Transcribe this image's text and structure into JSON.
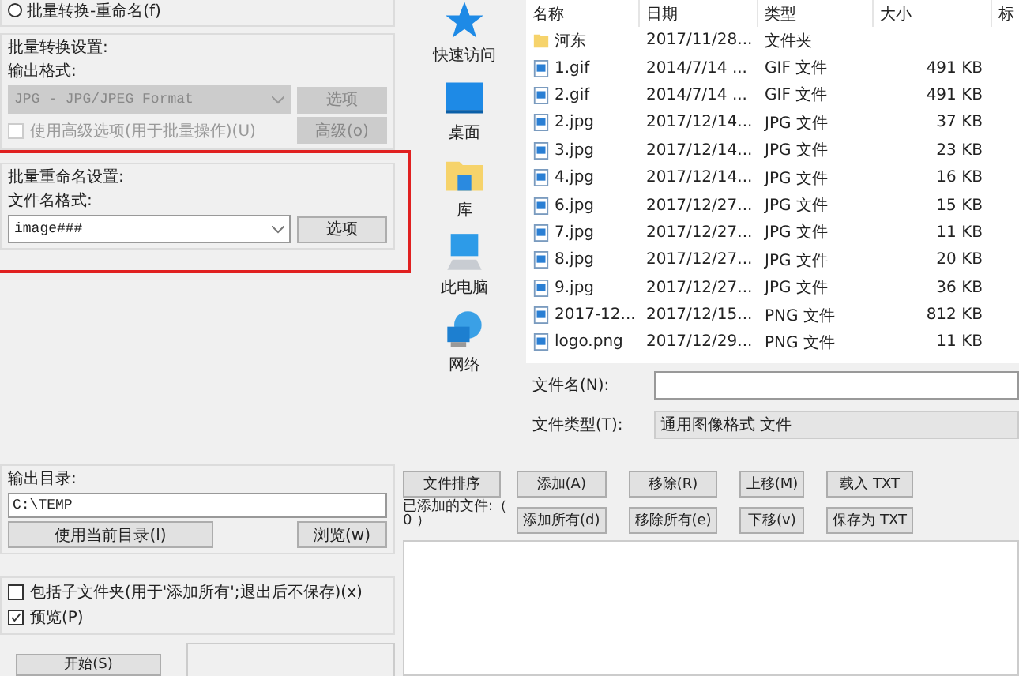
{
  "mode_radios": [
    {
      "label": "批量转换-重命名(f)",
      "selected": false
    }
  ],
  "convert_settings": {
    "title": "批量转换设置:",
    "format_label": "输出格式:",
    "format_value": "JPG - JPG/JPEG Format",
    "options_button": "选项",
    "disabled": true,
    "advanced_checkbox": {
      "label": "使用高级选项(用于批量操作)(U)",
      "checked": false
    },
    "advanced_button": "高级(o)"
  },
  "rename_settings": {
    "title": "批量重命名设置:",
    "pattern_label": "文件名格式:",
    "pattern_value": "image###",
    "options_button": "选项",
    "highlighted": true
  },
  "output_dir": {
    "title": "输出目录:",
    "value": "C:\\TEMP",
    "use_current_button": "使用当前目录(l)",
    "browse_button": "浏览(w)"
  },
  "options": [
    {
      "label": "包括子文件夹(用于'添加所有';退出后不保存)(x)",
      "checked": false
    },
    {
      "label": "预览(P)",
      "checked": true
    }
  ],
  "start_button": "开始(S)",
  "places": [
    {
      "label": "快速访问",
      "kind": "star"
    },
    {
      "label": "桌面",
      "kind": "desktop"
    },
    {
      "label": "库",
      "kind": "library"
    },
    {
      "label": "此电脑",
      "kind": "computer"
    },
    {
      "label": "网络",
      "kind": "network"
    }
  ],
  "file_table": {
    "columns": [
      "名称",
      "日期",
      "类型",
      "大小",
      "标"
    ],
    "rows": [
      {
        "kind": "folder",
        "name": "河东",
        "date": "2017/11/28...",
        "type": "文件夹",
        "size": ""
      },
      {
        "kind": "image",
        "name": "1.gif",
        "date": "2014/7/14 ...",
        "type": "GIF 文件",
        "size": "491 KB"
      },
      {
        "kind": "image",
        "name": "2.gif",
        "date": "2014/7/14 ...",
        "type": "GIF 文件",
        "size": "491 KB"
      },
      {
        "kind": "image",
        "name": "2.jpg",
        "date": "2017/12/14...",
        "type": "JPG 文件",
        "size": "37 KB"
      },
      {
        "kind": "image",
        "name": "3.jpg",
        "date": "2017/12/14...",
        "type": "JPG 文件",
        "size": "23 KB"
      },
      {
        "kind": "image",
        "name": "4.jpg",
        "date": "2017/12/14...",
        "type": "JPG 文件",
        "size": "16 KB"
      },
      {
        "kind": "image",
        "name": "6.jpg",
        "date": "2017/12/27...",
        "type": "JPG 文件",
        "size": "15 KB"
      },
      {
        "kind": "image",
        "name": "7.jpg",
        "date": "2017/12/27...",
        "type": "JPG 文件",
        "size": "11 KB"
      },
      {
        "kind": "image",
        "name": "8.jpg",
        "date": "2017/12/27...",
        "type": "JPG 文件",
        "size": "20 KB"
      },
      {
        "kind": "image",
        "name": "9.jpg",
        "date": "2017/12/27...",
        "type": "JPG 文件",
        "size": "36 KB"
      },
      {
        "kind": "image",
        "name": "2017-12...",
        "date": "2017/12/15...",
        "type": "PNG 文件",
        "size": "812 KB"
      },
      {
        "kind": "image",
        "name": "logo.png",
        "date": "2017/12/29...",
        "type": "PNG 文件",
        "size": "11 KB"
      }
    ]
  },
  "file_name_label": "文件名(N):",
  "file_type_label": "文件类型(T):",
  "file_type_value": "通用图像格式 文件",
  "sort_button": "文件排序",
  "added_label": "已添加的文件:（ 0 ）",
  "list_buttons": [
    [
      "添加(A)",
      "移除(R)",
      "上移(M)",
      "载入 TXT"
    ],
    [
      "添加所有(d)",
      "移除所有(e)",
      "下移(v)",
      "保存为 TXT"
    ]
  ]
}
